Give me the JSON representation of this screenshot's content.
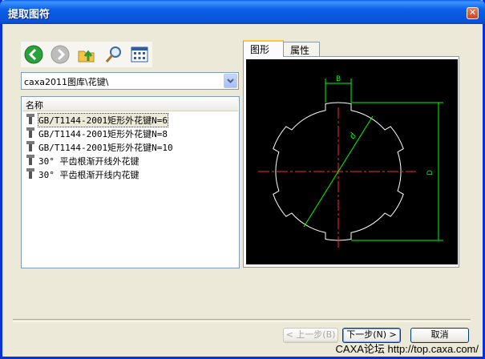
{
  "window": {
    "title": "提取图符"
  },
  "toolbar": {
    "buttons": [
      {
        "icon": "back-icon",
        "color": "#2ba13c"
      },
      {
        "icon": "forward-icon",
        "color": "#b8b8b8"
      },
      {
        "icon": "up-folder-icon"
      },
      {
        "icon": "search-icon"
      },
      {
        "icon": "view-icon"
      }
    ]
  },
  "path_combo": {
    "value": "caxa2011图库\\花键\\"
  },
  "list": {
    "column_header": "名称",
    "items": [
      {
        "label": "GB/T1144-2001矩形外花键N=6",
        "selected": true
      },
      {
        "label": "GB/T1144-2001矩形外花键N=8",
        "selected": false
      },
      {
        "label": "GB/T1144-2001矩形外花键N=10",
        "selected": false
      },
      {
        "label": "30° 平齿根渐开线外花键",
        "selected": false
      },
      {
        "label": "30° 平齿根渐开线内花键",
        "selected": false
      }
    ]
  },
  "tabs": [
    {
      "label": "图形",
      "active": true
    },
    {
      "label": "属性",
      "active": false
    }
  ],
  "preview": {
    "dim_top": "B",
    "dim_diag": "d",
    "dim_right": "D",
    "colors": {
      "outline": "#ffffff",
      "center": "#ff2a2a",
      "dimension": "#00ff00"
    }
  },
  "buttons": {
    "prev": "< 上一步(B)",
    "next": "下一步(N) >",
    "cancel": "取消"
  },
  "watermark": "CAXA论坛 http://top.caxa.com/"
}
